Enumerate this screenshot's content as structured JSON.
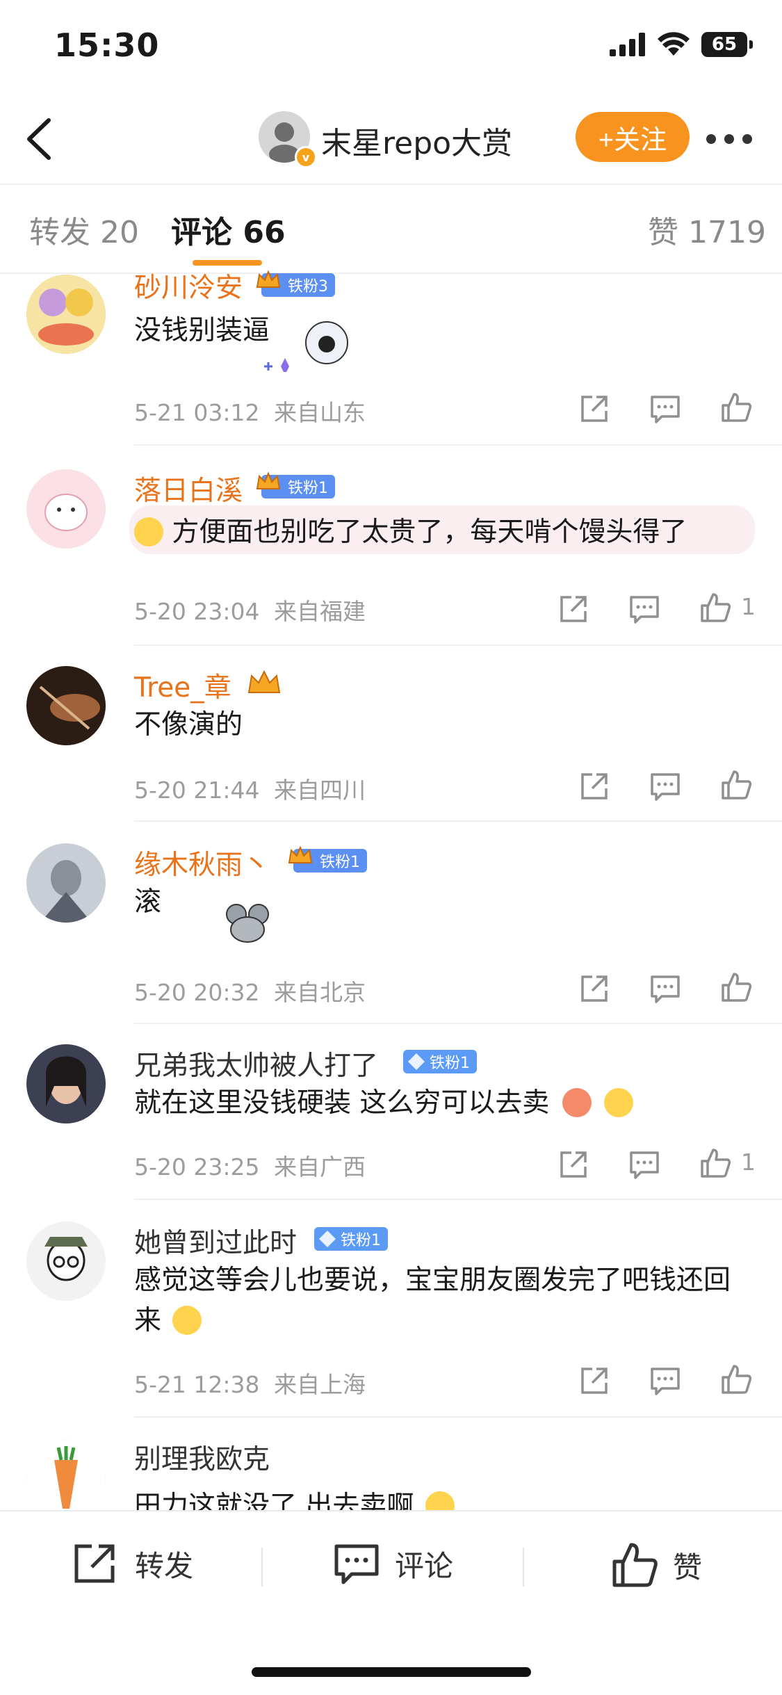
{
  "status": {
    "time": "15:30",
    "battery": "65"
  },
  "nav": {
    "title": "末星repo大赏",
    "follow": "+关注"
  },
  "tabs": [
    {
      "label": "转发",
      "count": "20"
    },
    {
      "label": "评论",
      "count": "66"
    },
    {
      "label": "赞",
      "count": "1719"
    }
  ],
  "colors": {
    "accent": "#f7931e",
    "username": "#e8731a",
    "badge": "#5b8ff2"
  },
  "comments": [
    {
      "name": "砂川泠安",
      "badge": "铁粉3",
      "text": "没钱别装逼",
      "time": "5-21 03:12",
      "location": "来自山东",
      "likes": ""
    },
    {
      "name": "落日白溪",
      "badge": "铁粉1",
      "text": "方便面也别吃了太贵了，每天啃个馒头得了",
      "time": "5-20 23:04",
      "location": "来自福建",
      "likes": "1"
    },
    {
      "name": "Tree_章",
      "badge": "",
      "text": "不像演的",
      "time": "5-20 21:44",
      "location": "来自四川",
      "likes": ""
    },
    {
      "name": "缘木秋雨丶",
      "badge": "铁粉1",
      "text": "滚",
      "time": "5-20 20:32",
      "location": "来自北京",
      "likes": ""
    },
    {
      "name": "兄弟我太帅被人打了",
      "badge": "铁粉1",
      "text": "就在这里没钱硬装 这么穷可以去卖",
      "time": "5-20 23:25",
      "location": "来自广西",
      "likes": "1"
    },
    {
      "name": "她曾到过此时",
      "badge": "铁粉1",
      "text": "感觉这等会儿也要说，宝宝朋友圈发完了吧钱还回来",
      "time": "5-21 12:38",
      "location": "来自上海",
      "likes": ""
    },
    {
      "name": "别理我欧克",
      "badge": "",
      "text": "田力这就没了 出去卖啊",
      "time": "",
      "location": "",
      "likes": ""
    }
  ],
  "bottom": {
    "repost": "转发",
    "comment": "评论",
    "like": "赞"
  },
  "icons": [
    "back-icon",
    "more-icon",
    "share-icon",
    "comment-icon",
    "like-icon",
    "crown-icon",
    "diamond-icon"
  ]
}
